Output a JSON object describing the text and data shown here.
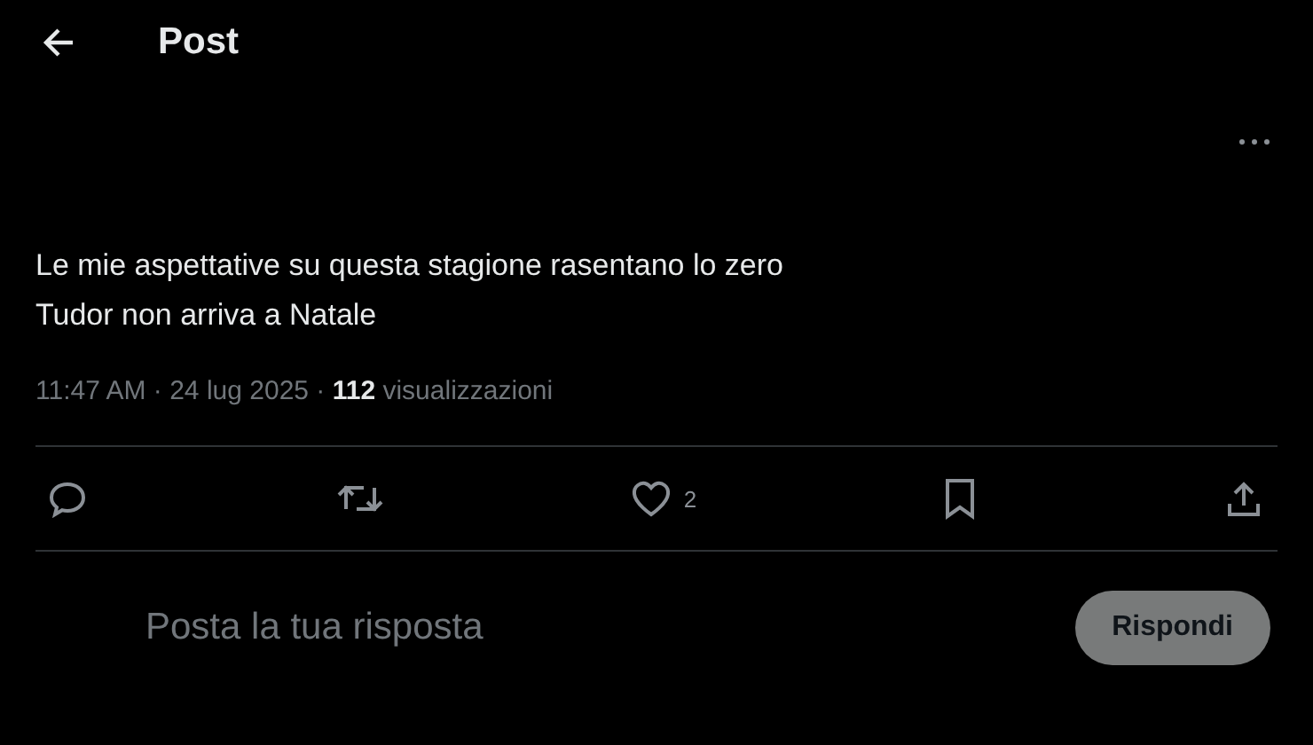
{
  "header": {
    "title": "Post"
  },
  "post": {
    "lines": [
      "Le mie aspettative su questa stagione rasentano lo zero",
      "Tudor non arriva a Natale"
    ],
    "meta": "11:47 AM · 24 lug 2025 · **112** visualizzazioni"
  },
  "actions": [
    {
      "kind": "reply"
    },
    {
      "kind": "repost"
    },
    {
      "kind": "like",
      "count": "2"
    },
    {
      "kind": "bookmark"
    },
    {
      "kind": "share"
    }
  ],
  "composer": {
    "placeholder": "Posta la tua risposta",
    "button": {
      "label": "Rispondi",
      "disabled": true
    }
  }
}
